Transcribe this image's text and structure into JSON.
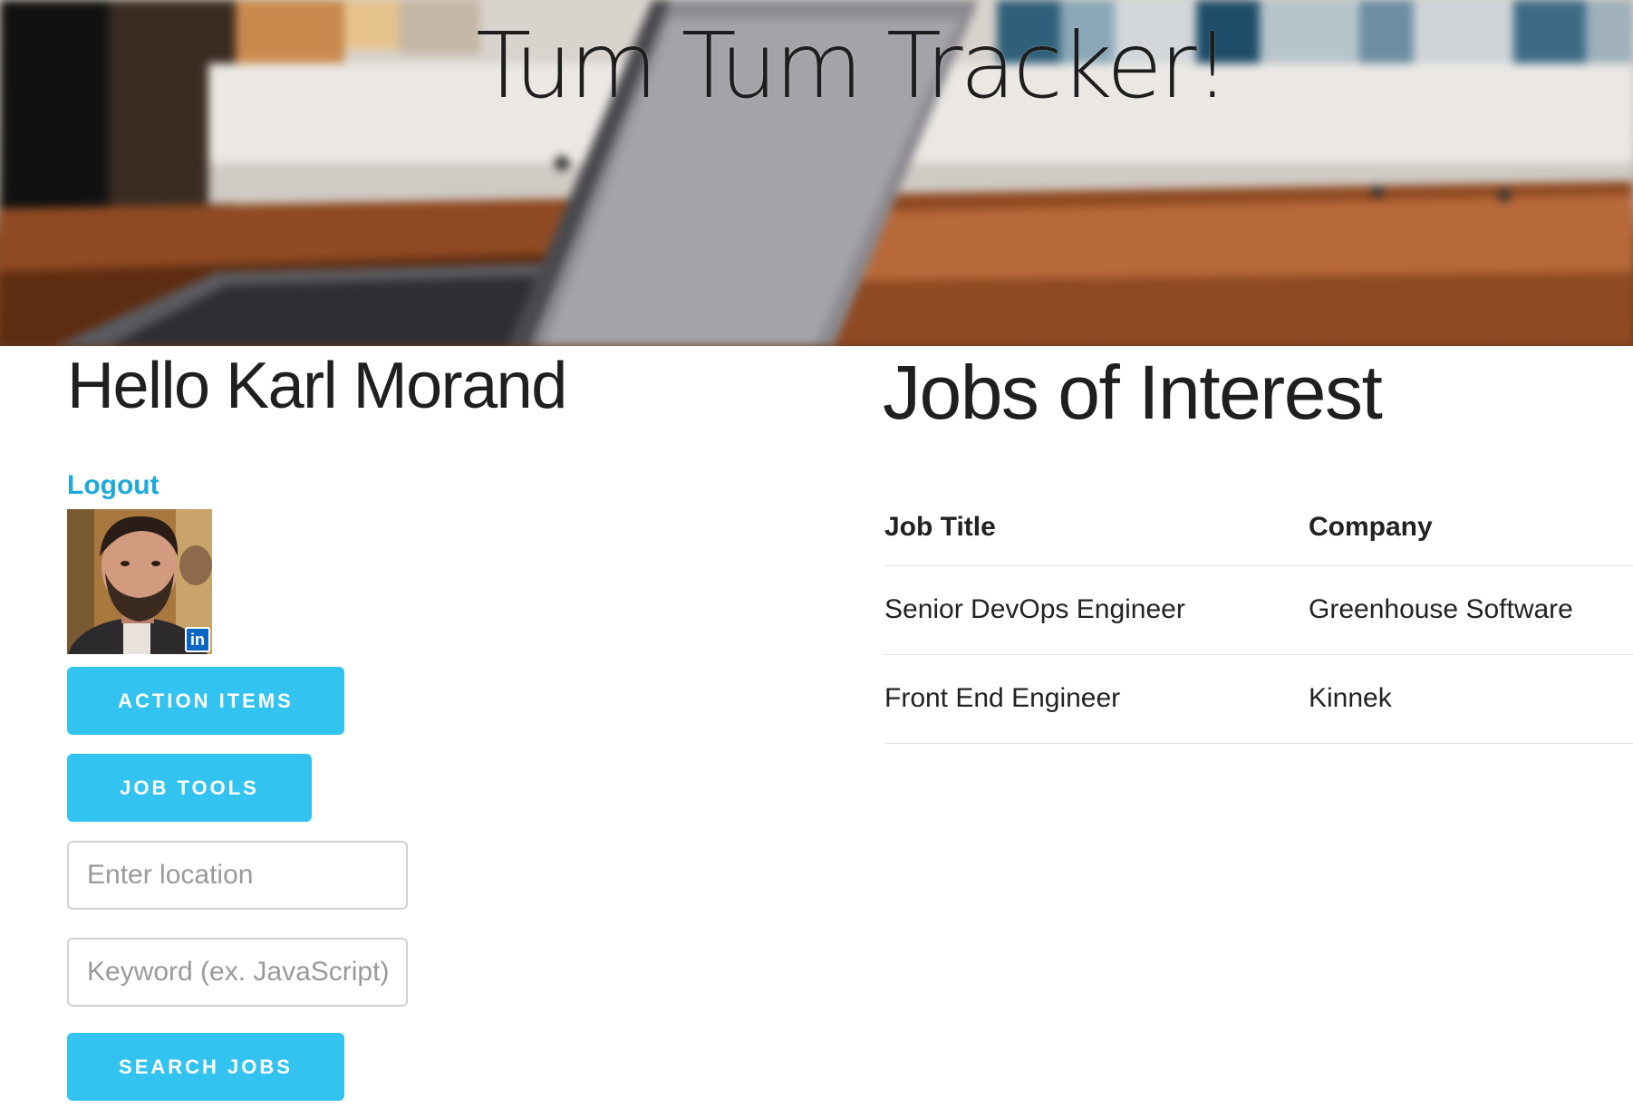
{
  "header": {
    "title": "Tum Tum Tracker!"
  },
  "profile": {
    "greeting": "Hello Karl Morand",
    "logout_label": "Logout",
    "avatar_badge": "in"
  },
  "actions": {
    "action_items_label": "ACTION ITEMS",
    "job_tools_label": "JOB TOOLS",
    "search_jobs_label": "SEARCH JOBS"
  },
  "search": {
    "location_placeholder": "Enter location",
    "location_value": "",
    "keyword_placeholder": "Keyword (ex. JavaScript)",
    "keyword_value": ""
  },
  "jobs": {
    "title": "Jobs of Interest",
    "columns": [
      "Job Title",
      "Company"
    ],
    "rows": [
      [
        "Senior DevOps Engineer",
        "Greenhouse Software"
      ],
      [
        "Front End Engineer",
        "Kinnek"
      ]
    ]
  },
  "colors": {
    "accent": "#33c3f0",
    "link": "#1ea9dc",
    "linkedin": "#0a66c2"
  }
}
